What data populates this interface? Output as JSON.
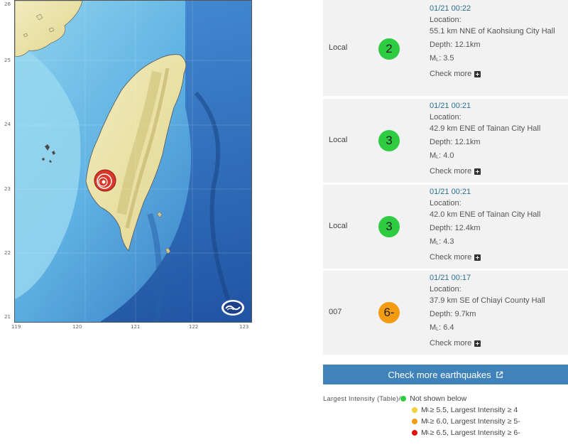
{
  "map": {
    "lat_ticks": [
      "26",
      "25",
      "24",
      "23",
      "22",
      "21"
    ],
    "lon_ticks": [
      "119",
      "120",
      "121",
      "122",
      "123"
    ],
    "logo_icon": "cwa-logo-icon",
    "epicenter_icon": "epicenter-marker-icon"
  },
  "earthquakes": [
    {
      "id": "Local",
      "intensity": "2",
      "color": "#2ecc40",
      "time": "01/21 00:22",
      "location_label": "Location:",
      "location": "55.1 km NNE of Kaohsiung City Hall",
      "depth": "Depth: 12.1km",
      "magnitude_prefix": "M",
      "magnitude_sub": "L",
      "magnitude": ": 3.5",
      "check_more": "Check more"
    },
    {
      "id": "Local",
      "intensity": "3",
      "color": "#2ecc40",
      "time": "01/21 00:21",
      "location_label": "Location:",
      "location": "42.9 km ENE of Tainan City Hall",
      "depth": "Depth: 12.1km",
      "magnitude_prefix": "M",
      "magnitude_sub": "L",
      "magnitude": ": 4.0",
      "check_more": "Check more"
    },
    {
      "id": "Local",
      "intensity": "3",
      "color": "#2ecc40",
      "time": "01/21 00:21",
      "location_label": "Location:",
      "location": "42.0 km ENE of Tainan City Hall",
      "depth": "Depth: 12.4km",
      "magnitude_prefix": "M",
      "magnitude_sub": "L",
      "magnitude": ": 4.3",
      "check_more": "Check more"
    },
    {
      "id": "007",
      "intensity": "6-",
      "color": "#f39c12",
      "time": "01/21 00:17",
      "location_label": "Location:",
      "location": "37.9 km SE of Chiayi County Hall",
      "depth": "Depth: 9.7km",
      "magnitude_prefix": "M",
      "magnitude_sub": "L",
      "magnitude": ": 6.4",
      "check_more": "Check more"
    }
  ],
  "more_button": {
    "label": "Check more earthquakes",
    "icon": "external-link-icon"
  },
  "legend": {
    "title": "Largest Intensity (Table)/",
    "items": [
      {
        "color": "#2ecc40",
        "prefix": "",
        "sub": "",
        "text": "Not shown below"
      },
      {
        "color": "#f4d03f",
        "prefix": "M",
        "sub": "L",
        "text": " ≥ 5.5, Largest Intensity ≥ 4"
      },
      {
        "color": "#f39c12",
        "prefix": "M",
        "sub": "L",
        "text": " ≥ 6.0, Largest Intensity ≥ 5-"
      },
      {
        "color": "#e01010",
        "prefix": "M",
        "sub": "L",
        "text": " ≥ 6.5, Largest Intensity ≥ 6-"
      }
    ]
  }
}
